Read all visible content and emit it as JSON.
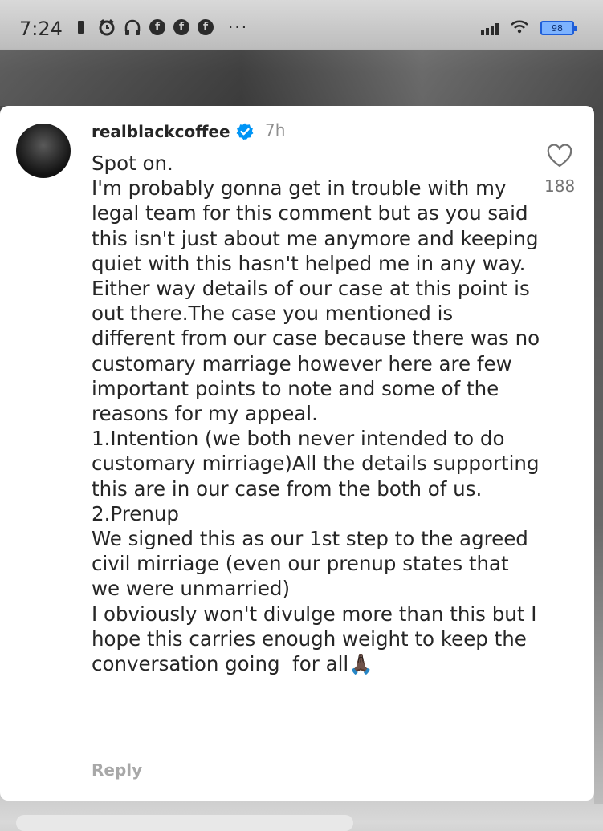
{
  "status_bar": {
    "time": "7:24",
    "battery": "98",
    "icons": [
      "sim-icon",
      "alarm-icon",
      "headphones-icon",
      "facebook-icon",
      "facebook-icon",
      "facebook-icon",
      "more-icon"
    ],
    "fb_glyph": "f",
    "more": "···"
  },
  "comment": {
    "username": "realblackcoffee",
    "verified": true,
    "time_ago": "7h",
    "text": "Spot on.\nI'm probably gonna get in trouble with my legal team for this comment but as you said this isn't just about me anymore and keeping quiet with this hasn't helped me in any way.\nEither way details of our case at this point is out there.The case you mentioned is different from our case because there was no customary marriage however here are few important points to note and some of the reasons for my appeal.\n1.Intention (we both never intended to do customary mirriage)All the details supporting this are in our case from the both of us.\n2.Prenup\nWe signed this as our 1st step to the agreed civil mirriage (even our prenup states that we were unmarried)\nI obviously won't divulge more than this but I hope this carries enough weight to keep the conversation going  for all🙏🏿",
    "likes": "188",
    "reply_label": "Reply"
  },
  "colors": {
    "verified_blue": "#0095f6",
    "text": "#262626",
    "muted": "#8e8e8e"
  }
}
